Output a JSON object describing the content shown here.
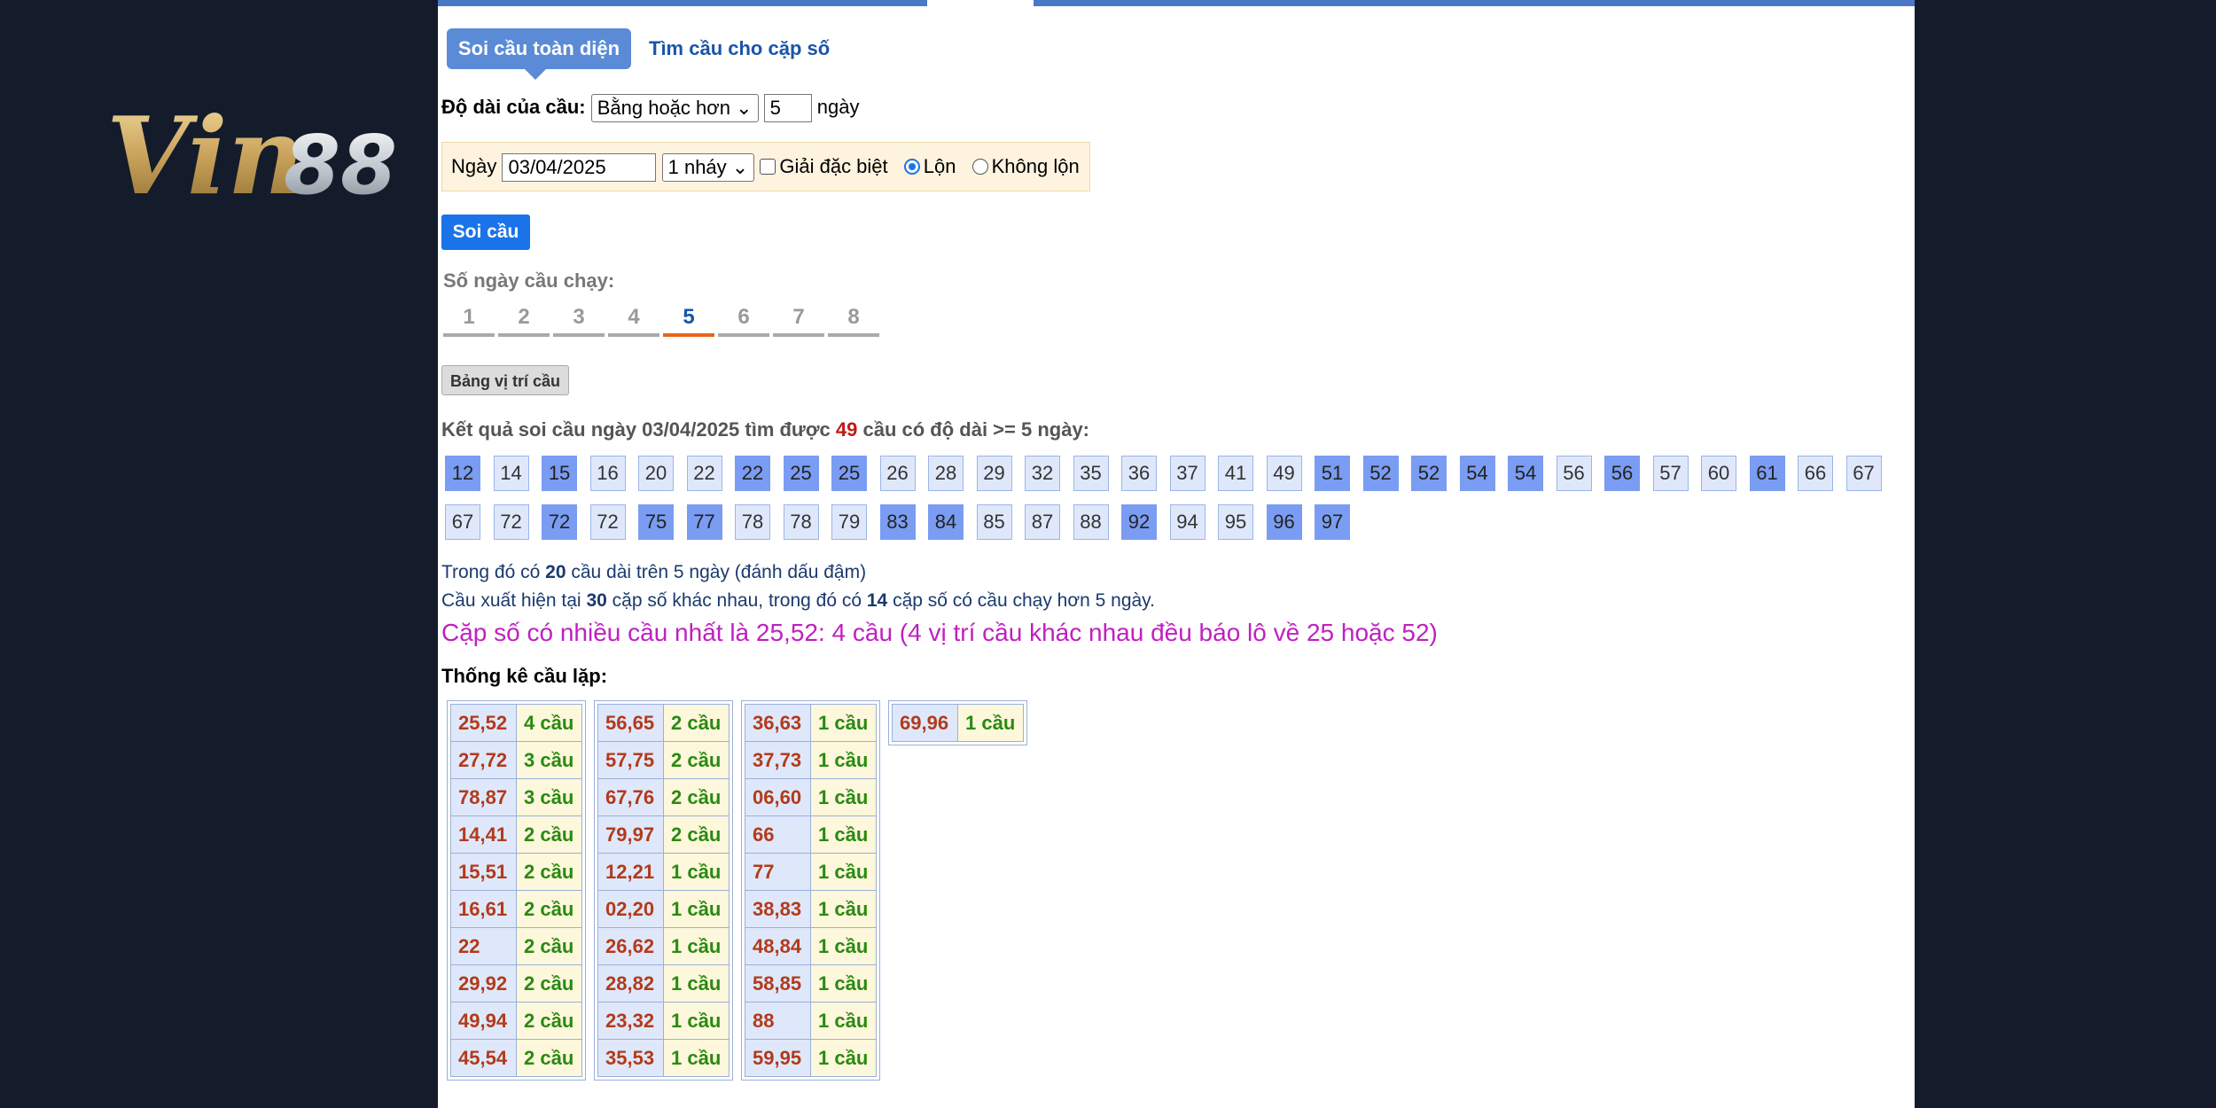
{
  "logo_text": "Vin88",
  "tabs": {
    "active": "Soi cầu toàn diện",
    "other": "Tìm cầu cho cặp số"
  },
  "length_row": {
    "label": "Độ dài của cầu:",
    "select_value": "Bằng hoặc hơn",
    "days_value": "5",
    "unit": "ngày"
  },
  "filter": {
    "date_label": "Ngày",
    "date_value": "03/04/2025",
    "jump_value": "1 nháy",
    "special_label": "Giải đặc biệt",
    "radio_on": "Lộn",
    "radio_off": "Không lộn"
  },
  "submit_label": "Soi cầu",
  "days_label": "Số ngày cầu chạy:",
  "day_tabs": [
    "1",
    "2",
    "3",
    "4",
    "5",
    "6",
    "7",
    "8"
  ],
  "active_day": "5",
  "map_button": "Bảng vị trí cầu",
  "result": {
    "prefix": "Kết quả soi cầu ngày 03/04/2025 tìm được",
    "count": "49",
    "suffix": "cầu có độ dài >= 5 ngày:"
  },
  "chips_row1": [
    {
      "v": "12",
      "b": true
    },
    {
      "v": "14",
      "b": false
    },
    {
      "v": "15",
      "b": true
    },
    {
      "v": "16",
      "b": false
    },
    {
      "v": "20",
      "b": false
    },
    {
      "v": "22",
      "b": false
    },
    {
      "v": "22",
      "b": true
    },
    {
      "v": "25",
      "b": true
    },
    {
      "v": "25",
      "b": true
    },
    {
      "v": "26",
      "b": false
    },
    {
      "v": "28",
      "b": false
    },
    {
      "v": "29",
      "b": false
    },
    {
      "v": "32",
      "b": false
    },
    {
      "v": "35",
      "b": false
    },
    {
      "v": "36",
      "b": false
    },
    {
      "v": "37",
      "b": false
    },
    {
      "v": "41",
      "b": false
    },
    {
      "v": "49",
      "b": false
    },
    {
      "v": "51",
      "b": true
    },
    {
      "v": "52",
      "b": true
    },
    {
      "v": "52",
      "b": true
    },
    {
      "v": "54",
      "b": true
    },
    {
      "v": "54",
      "b": true
    },
    {
      "v": "56",
      "b": false
    },
    {
      "v": "56",
      "b": true
    },
    {
      "v": "57",
      "b": false
    },
    {
      "v": "60",
      "b": false
    },
    {
      "v": "61",
      "b": true
    },
    {
      "v": "66",
      "b": false
    },
    {
      "v": "67",
      "b": false
    }
  ],
  "chips_row2": [
    {
      "v": "67",
      "b": false
    },
    {
      "v": "72",
      "b": false
    },
    {
      "v": "72",
      "b": true
    },
    {
      "v": "72",
      "b": false
    },
    {
      "v": "75",
      "b": true
    },
    {
      "v": "77",
      "b": true
    },
    {
      "v": "78",
      "b": false
    },
    {
      "v": "78",
      "b": false
    },
    {
      "v": "79",
      "b": false
    },
    {
      "v": "83",
      "b": true
    },
    {
      "v": "84",
      "b": true
    },
    {
      "v": "85",
      "b": false
    },
    {
      "v": "87",
      "b": false
    },
    {
      "v": "88",
      "b": false
    },
    {
      "v": "92",
      "b": true
    },
    {
      "v": "94",
      "b": false
    },
    {
      "v": "95",
      "b": false
    },
    {
      "v": "96",
      "b": true
    },
    {
      "v": "97",
      "b": true
    }
  ],
  "note1": {
    "a": "Trong đó có",
    "n": "20",
    "b": "cầu dài trên 5 ngày (đánh dấu đậm)"
  },
  "note2": {
    "a": "Cầu xuất hiện tại",
    "n1": "30",
    "b": "cặp số khác nhau, trong đó có",
    "n2": "14",
    "c": "cặp số có cầu chạy hơn 5 ngày."
  },
  "highlight": "Cặp số có nhiều cầu nhất là 25,52: 4 cầu (4 vị trí cầu khác nhau đều báo lô về 25 hoặc 52)",
  "stat_title": "Thống kê cầu lặp:",
  "stats": [
    [
      [
        "25,52",
        "4 cầu"
      ],
      [
        "27,72",
        "3 cầu"
      ],
      [
        "78,87",
        "3 cầu"
      ],
      [
        "14,41",
        "2 cầu"
      ],
      [
        "15,51",
        "2 cầu"
      ],
      [
        "16,61",
        "2 cầu"
      ],
      [
        "22",
        "2 cầu"
      ],
      [
        "29,92",
        "2 cầu"
      ],
      [
        "49,94",
        "2 cầu"
      ],
      [
        "45,54",
        "2 cầu"
      ]
    ],
    [
      [
        "56,65",
        "2 cầu"
      ],
      [
        "57,75",
        "2 cầu"
      ],
      [
        "67,76",
        "2 cầu"
      ],
      [
        "79,97",
        "2 cầu"
      ],
      [
        "12,21",
        "1 cầu"
      ],
      [
        "02,20",
        "1 cầu"
      ],
      [
        "26,62",
        "1 cầu"
      ],
      [
        "28,82",
        "1 cầu"
      ],
      [
        "23,32",
        "1 cầu"
      ],
      [
        "35,53",
        "1 cầu"
      ]
    ],
    [
      [
        "36,63",
        "1 cầu"
      ],
      [
        "37,73",
        "1 cầu"
      ],
      [
        "06,60",
        "1 cầu"
      ],
      [
        "66",
        "1 cầu"
      ],
      [
        "77",
        "1 cầu"
      ],
      [
        "38,83",
        "1 cầu"
      ],
      [
        "48,84",
        "1 cầu"
      ],
      [
        "58,85",
        "1 cầu"
      ],
      [
        "88",
        "1 cầu"
      ],
      [
        "59,95",
        "1 cầu"
      ]
    ],
    [
      [
        "69,96",
        "1 cầu"
      ]
    ]
  ]
}
